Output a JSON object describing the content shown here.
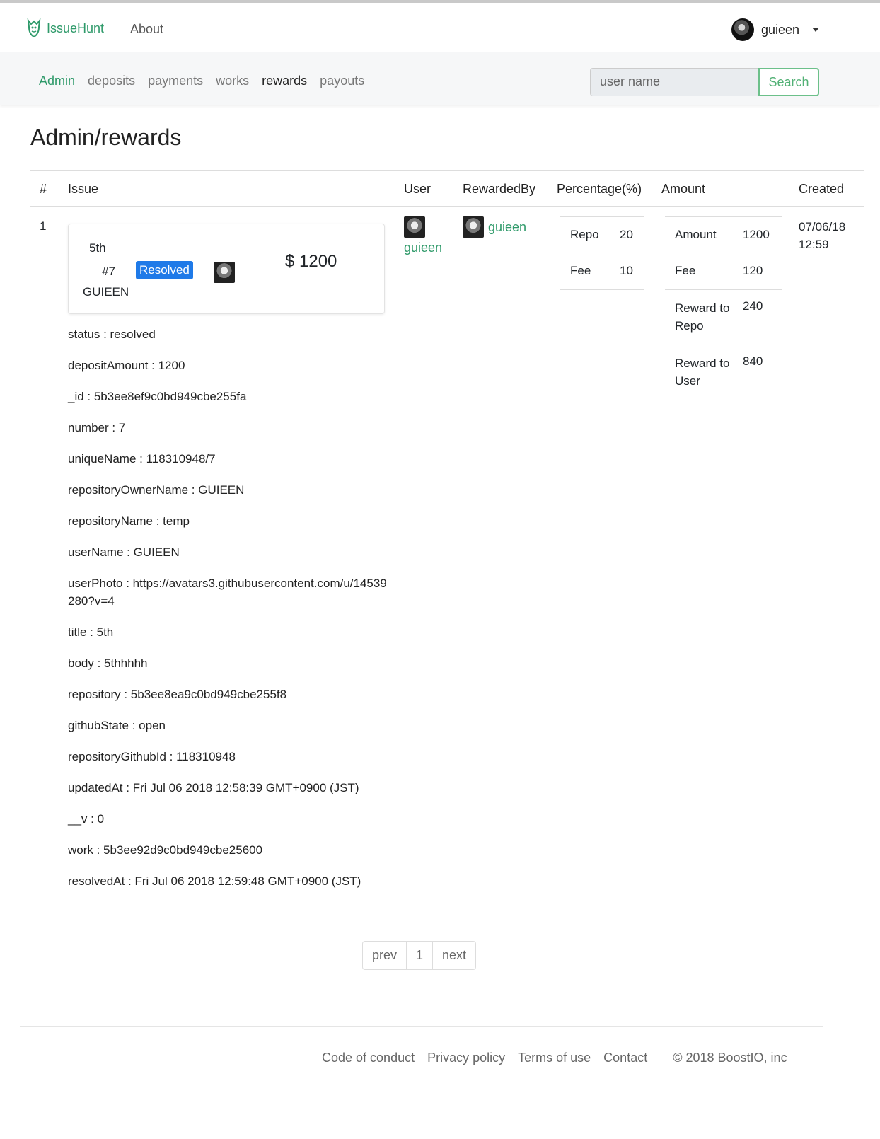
{
  "header": {
    "brand": "IssueHunt",
    "about": "About",
    "username": "guieen"
  },
  "subnav": {
    "items": [
      "Admin",
      "deposits",
      "payments",
      "works",
      "rewards",
      "payouts"
    ],
    "search_placeholder": "user name",
    "search_button": "Search"
  },
  "page_title": "Admin/rewards",
  "table": {
    "headers": [
      "#",
      "Issue",
      "User",
      "RewardedBy",
      "Percentage(%)",
      "Amount",
      "Created"
    ],
    "row": {
      "num": "1",
      "card": {
        "title": "5th",
        "number": "#7",
        "badge": "Resolved",
        "owner": "GUIEEN",
        "amount": "$ 1200"
      },
      "details": [
        "status : resolved",
        "depositAmount : 1200",
        "_id : 5b3ee8ef9c0bd949cbe255fa",
        "number : 7",
        "uniqueName : 118310948/7",
        "repositoryOwnerName : GUIEEN",
        "repositoryName : temp",
        "userName : GUIEEN",
        "userPhoto : https://avatars3.githubusercontent.com/u/14539280?v=4",
        "title : 5th",
        "body : 5thhhhh",
        "repository : 5b3ee8ea9c0bd949cbe255f8",
        "githubState : open",
        "repositoryGithubId : 118310948",
        "updatedAt : Fri Jul 06 2018 12:58:39 GMT+0900 (JST)",
        "__v : 0",
        "work : 5b3ee92d9c0bd949cbe25600",
        "resolvedAt : Fri Jul 06 2018 12:59:48 GMT+0900 (JST)"
      ],
      "user": "guieen",
      "rewarded_by": "guieen",
      "percentage": [
        {
          "k": "Repo",
          "v": "20"
        },
        {
          "k": "Fee",
          "v": "10"
        }
      ],
      "amount": [
        {
          "k": "Amount",
          "v": "1200"
        },
        {
          "k": "Fee",
          "v": "120"
        },
        {
          "k": "Reward to Repo",
          "v": "240"
        },
        {
          "k": "Reward to User",
          "v": "840"
        }
      ],
      "created_date": "07/06/18",
      "created_time": "12:59"
    }
  },
  "pagination": {
    "prev": "prev",
    "page": "1",
    "next": "next"
  },
  "footer": {
    "links": [
      "Code of conduct",
      "Privacy policy",
      "Terms of use",
      "Contact"
    ],
    "copyright": "© 2018 BoostIO, inc"
  }
}
